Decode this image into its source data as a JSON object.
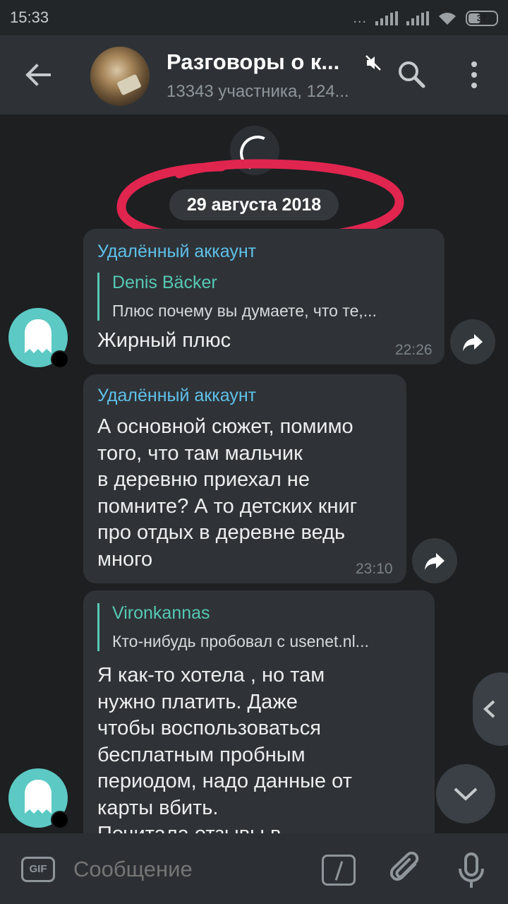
{
  "status_bar": {
    "time": "15:33",
    "dots": "...",
    "battery": "37"
  },
  "header": {
    "title": "Разговоры о к...",
    "subtitle": "13343 участника, 124...",
    "icons": [
      "back-arrow-icon",
      "muted-speaker-icon",
      "search-icon",
      "more-vert-icon"
    ]
  },
  "chat": {
    "date_label": "29 августа 2018",
    "messages": [
      {
        "sender": "Удалённый аккаунт",
        "reply_name": "Denis Bäcker",
        "reply_text": "Плюс почему вы думаете, что те,...",
        "text": "Жирный плюс",
        "time": "22:26"
      },
      {
        "sender": "Удалённый аккаунт",
        "text": "А основной сюжет, помимо\nтого, что там мальчик\nв деревню приехал не\nпомните? А то детских книг\nпро отдых в деревне ведь\nмного",
        "time": "23:10"
      },
      {
        "reply_name": "Vironkannas",
        "reply_text": "Кто-нибудь пробовал с usenet.nl...",
        "text": "Я как-то хотела , но там\nнужно платить. Даже\nчтобы воспользоваться\nбесплатным пробным\nпериодом, надо данные от\nкарты вбить.\nПочитала отзывы в"
      }
    ]
  },
  "input": {
    "gif_label": "GIF",
    "placeholder": "Сообщение"
  },
  "colors": {
    "accent_sender": "#5fc1eb",
    "reply_accent": "#56c9b4",
    "annotation_red": "#e0254f"
  }
}
